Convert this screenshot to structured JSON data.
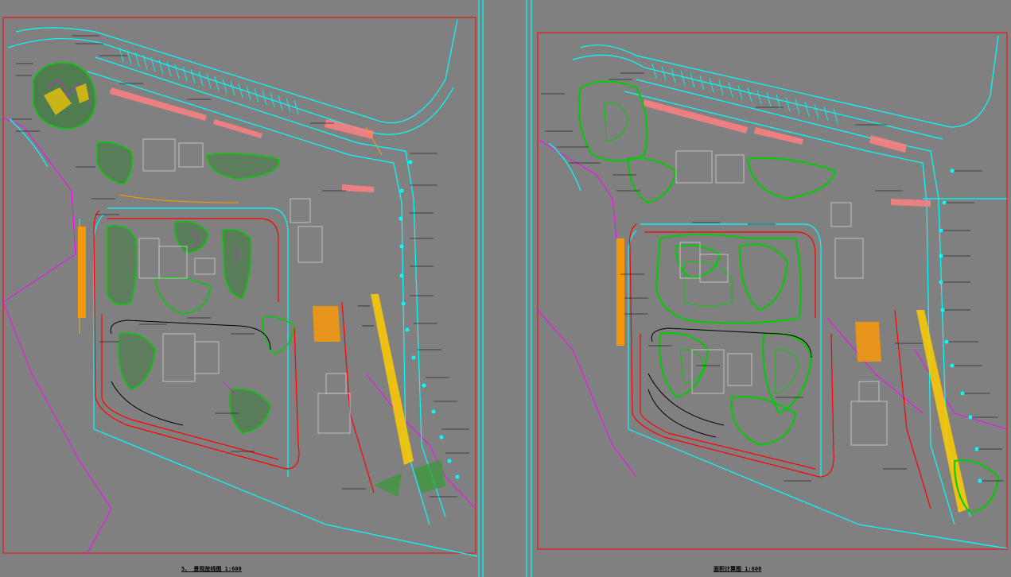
{
  "sheets": {
    "left": {
      "title": "5、 景观放线图 1:600"
    },
    "right": {
      "title": "面积计算图 1:600"
    }
  },
  "colors": {
    "background": "#808080",
    "frame": "#ff0000",
    "cyan": "#00ffff",
    "green": "#00cc00",
    "magenta": "#ff00ff",
    "orange": "#ff9900",
    "salmon": "#ff8080",
    "white": "#e0e0e0",
    "black": "#000000",
    "yellow": "#ffcc00"
  }
}
